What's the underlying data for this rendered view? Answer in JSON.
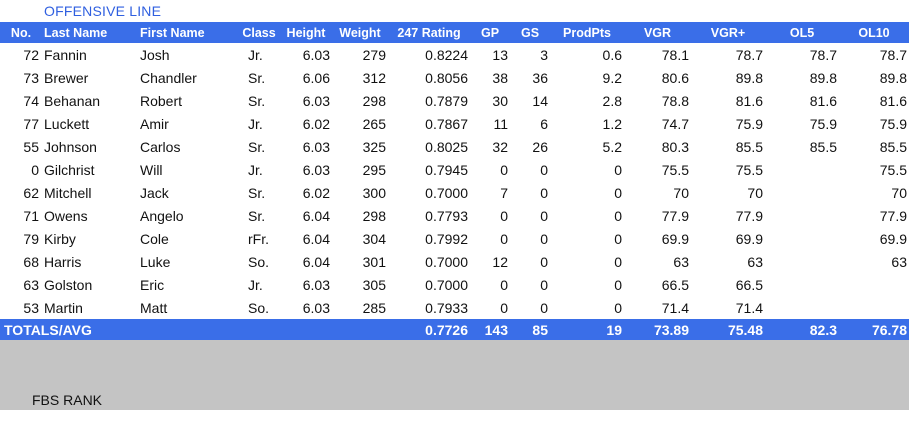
{
  "title": "OFFENSIVE LINE",
  "headers": [
    "No.",
    "Last Name",
    "First Name",
    "Class",
    "Height",
    "Weight",
    "247 Rating",
    "GP",
    "GS",
    "ProdPts",
    "VGR",
    "VGR+",
    "OL5",
    "OL10"
  ],
  "rows": [
    [
      "72",
      "Fannin",
      "Josh",
      "Jr.",
      "6.03",
      "279",
      "0.8224",
      "13",
      "3",
      "0.6",
      "78.1",
      "78.7",
      "78.7",
      "78.7"
    ],
    [
      "73",
      "Brewer",
      "Chandler",
      "Sr.",
      "6.06",
      "312",
      "0.8056",
      "38",
      "36",
      "9.2",
      "80.6",
      "89.8",
      "89.8",
      "89.8"
    ],
    [
      "74",
      "Behanan",
      "Robert",
      "Sr.",
      "6.03",
      "298",
      "0.7879",
      "30",
      "14",
      "2.8",
      "78.8",
      "81.6",
      "81.6",
      "81.6"
    ],
    [
      "77",
      "Luckett",
      "Amir",
      "Jr.",
      "6.02",
      "265",
      "0.7867",
      "11",
      "6",
      "1.2",
      "74.7",
      "75.9",
      "75.9",
      "75.9"
    ],
    [
      "55",
      "Johnson",
      "Carlos",
      "Sr.",
      "6.03",
      "325",
      "0.8025",
      "32",
      "26",
      "5.2",
      "80.3",
      "85.5",
      "85.5",
      "85.5"
    ],
    [
      "0",
      "Gilchrist",
      "Will",
      "Jr.",
      "6.03",
      "295",
      "0.7945",
      "0",
      "0",
      "0",
      "75.5",
      "75.5",
      "",
      "75.5"
    ],
    [
      "62",
      "Mitchell",
      "Jack",
      "Sr.",
      "6.02",
      "300",
      "0.7000",
      "7",
      "0",
      "0",
      "70",
      "70",
      "",
      "70"
    ],
    [
      "71",
      "Owens",
      "Angelo",
      "Sr.",
      "6.04",
      "298",
      "0.7793",
      "0",
      "0",
      "0",
      "77.9",
      "77.9",
      "",
      "77.9"
    ],
    [
      "79",
      "Kirby",
      "Cole",
      "rFr.",
      "6.04",
      "304",
      "0.7992",
      "0",
      "0",
      "0",
      "69.9",
      "69.9",
      "",
      "69.9"
    ],
    [
      "68",
      "Harris",
      "Luke",
      "So.",
      "6.04",
      "301",
      "0.7000",
      "12",
      "0",
      "0",
      "63",
      "63",
      "",
      "63"
    ],
    [
      "63",
      "Golston",
      "Eric",
      "Jr.",
      "6.03",
      "305",
      "0.7000",
      "0",
      "0",
      "0",
      "66.5",
      "66.5",
      "",
      ""
    ],
    [
      "53",
      "Martin",
      "Matt",
      "So.",
      "6.03",
      "285",
      "0.7933",
      "0",
      "0",
      "0",
      "71.4",
      "71.4",
      "",
      ""
    ]
  ],
  "totals": {
    "label": "TOTALS/AVG",
    "rating": "0.7726",
    "gp": "143",
    "gs": "85",
    "prodpts": "19",
    "vgr": "73.89",
    "vgr_plus": "75.48",
    "ol5": "82.3",
    "ol10": "76.78"
  },
  "fbs_rank_label": "FBS RANK",
  "colors": {
    "header_blue": "#3a6ee8",
    "title_blue": "#2f5fe0",
    "gray_band": "#c4c4c4"
  }
}
